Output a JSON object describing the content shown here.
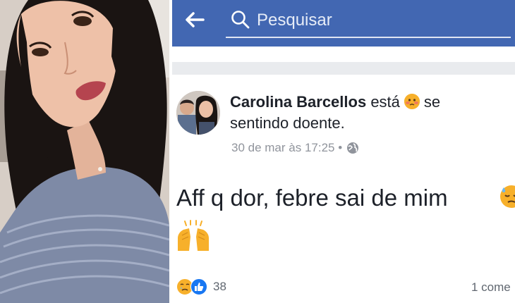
{
  "header": {
    "search_placeholder": "Pesquisar"
  },
  "post": {
    "author": "Carolina Barcellos",
    "feeling_prefix": "está",
    "feeling_suffix": "se",
    "feeling_line2": "sentindo doente.",
    "timestamp": "30 de mar às 17:25 •",
    "text": "Aff q dor, febre sai de mim",
    "reaction_count": "38",
    "comments_label": "1 come"
  },
  "icons": {
    "back": "back-arrow-icon",
    "search": "search-icon",
    "privacy": "globe-icon",
    "feeling": "sick-face-emoji",
    "sweat": "downcast-sweat-emoji",
    "hands": "raised-hands-emoji",
    "reaction_sad": "sad-reaction-icon",
    "reaction_like": "like-reaction-icon"
  },
  "colors": {
    "brand": "#4267b2",
    "like_blue": "#1877f2",
    "emoji_yellow": "#f7b02b"
  }
}
